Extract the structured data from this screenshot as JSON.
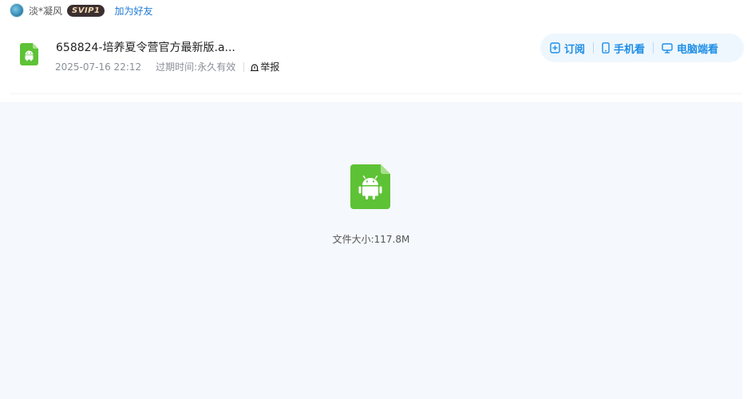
{
  "user": {
    "name": "淡*凝风",
    "vip_badge": "SVIP1",
    "add_friend_label": "加为好友"
  },
  "file": {
    "name": "658824-培养夏令营官方最新版.a...",
    "date": "2025-07-16 22:12",
    "expiry_label": "过期时间:",
    "expiry_value": "永久有效",
    "report_label": "举报",
    "size_label": "文件大小:",
    "size_value": "117.8M",
    "icon": "android-file-icon"
  },
  "actions": {
    "subscribe_label": "订阅",
    "mobile_label": "手机看",
    "desktop_label": "电脑端看"
  },
  "colors": {
    "accent": "#1e8ee6",
    "android_green": "#5ec236",
    "preview_bg": "#f5f8fc"
  }
}
